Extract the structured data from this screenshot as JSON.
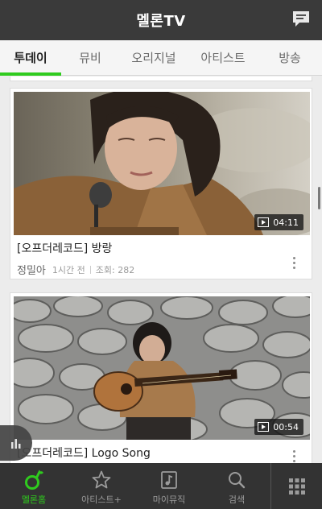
{
  "header": {
    "title": "멜론TV",
    "chat_icon": "chat-bubble-icon"
  },
  "tabs": [
    {
      "label": "투데이",
      "active": true
    },
    {
      "label": "뮤비",
      "active": false
    },
    {
      "label": "오리지널",
      "active": false
    },
    {
      "label": "아티스트",
      "active": false
    },
    {
      "label": "방송",
      "active": false
    }
  ],
  "videos": [
    {
      "title": "[오프더레코드] 방랑",
      "artist": "정밀아",
      "time_ago": "1시간 전",
      "views": "조회: 282",
      "duration": "04:11"
    },
    {
      "title": "[오프더레코드] Logo Song",
      "duration": "00:54"
    }
  ],
  "bottom_nav": [
    {
      "label": "멜론홈",
      "icon": "melon-home-icon",
      "active": true
    },
    {
      "label": "아티스트+",
      "icon": "star-icon",
      "active": false
    },
    {
      "label": "마이뮤직",
      "icon": "my-music-icon",
      "active": false
    },
    {
      "label": "검색",
      "icon": "search-icon",
      "active": false
    }
  ],
  "colors": {
    "accent": "#2fcb1e",
    "header_bg": "#3a3a3a",
    "nav_bg": "#333333"
  }
}
